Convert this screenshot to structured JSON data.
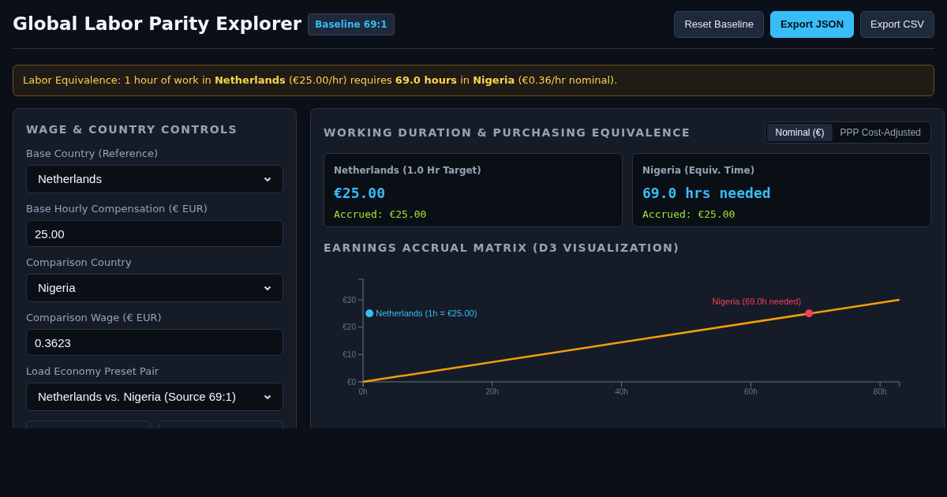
{
  "header": {
    "title": "Global Labor Parity Explorer",
    "badge": "Baseline 69:1",
    "buttons": [
      {
        "label": "Reset Baseline",
        "kind": "secondary"
      },
      {
        "label": "Export JSON",
        "kind": "primary"
      },
      {
        "label": "Export CSV",
        "kind": "secondary"
      }
    ]
  },
  "alert": "Labor Equivalence: 1 hour of work in **Netherlands** (€25.00/hr) requires **69.0 hours** in **Nigeria** (€0.36/hr nominal).",
  "controls": {
    "title": "WAGE & COUNTRY CONTROLS",
    "fields": [
      {
        "label": "Base Country (Reference)",
        "kind": "select",
        "value": "Netherlands"
      },
      {
        "label": "Base Hourly Compensation (€ EUR)",
        "kind": "input",
        "value": "25.00"
      },
      {
        "label": "Comparison Country",
        "kind": "select",
        "value": "Nigeria"
      },
      {
        "label": "Comparison Wage (€ EUR)",
        "kind": "input",
        "value": "0.3623"
      },
      {
        "label": "Load Economy Preset Pair",
        "kind": "select",
        "value": "Netherlands vs. Nigeria (Source 69:1)"
      }
    ]
  },
  "equivalence": {
    "title": "WORKING DURATION & PURCHASING EQUIVALENCE",
    "modes": [
      {
        "label": "Nominal (€)",
        "selected": true
      },
      {
        "label": "PPP Cost-Adjusted",
        "selected": false
      }
    ],
    "cards": [
      {
        "title": "Netherlands (1.0 Hr Target)",
        "value": "€25.00",
        "accrued": "Accrued: €25.00"
      },
      {
        "title": "Nigeria (Equiv. Time)",
        "value": "69.0 hrs needed",
        "accrued": "Accrued: €25.00"
      }
    ]
  },
  "matrix": {
    "title": "EARNINGS ACCRUAL MATRIX (D3 VISUALIZATION)",
    "chart_data": {
      "type": "line",
      "x": [
        0,
        83
      ],
      "values": [
        0,
        30
      ],
      "xlim": [
        0,
        83
      ],
      "ylim": [
        0,
        37.5
      ],
      "xticks": [
        {
          "value": 0,
          "label": "0h"
        },
        {
          "value": 20,
          "label": "20h"
        },
        {
          "value": 40,
          "label": "40h"
        },
        {
          "value": 60,
          "label": "60h"
        },
        {
          "value": 80,
          "label": "80h"
        }
      ],
      "yticks": [
        {
          "value": 0,
          "label": "€0"
        },
        {
          "value": 10,
          "label": "€10"
        },
        {
          "value": 20,
          "label": "€20"
        },
        {
          "value": 30,
          "label": "€30"
        }
      ],
      "annotations": [
        {
          "x": 1,
          "y": 25,
          "text": "Netherlands (1h = €25.00)"
        },
        {
          "x": 69,
          "y": 25,
          "text": "Nigeria (69.0h needed)"
        }
      ]
    }
  }
}
